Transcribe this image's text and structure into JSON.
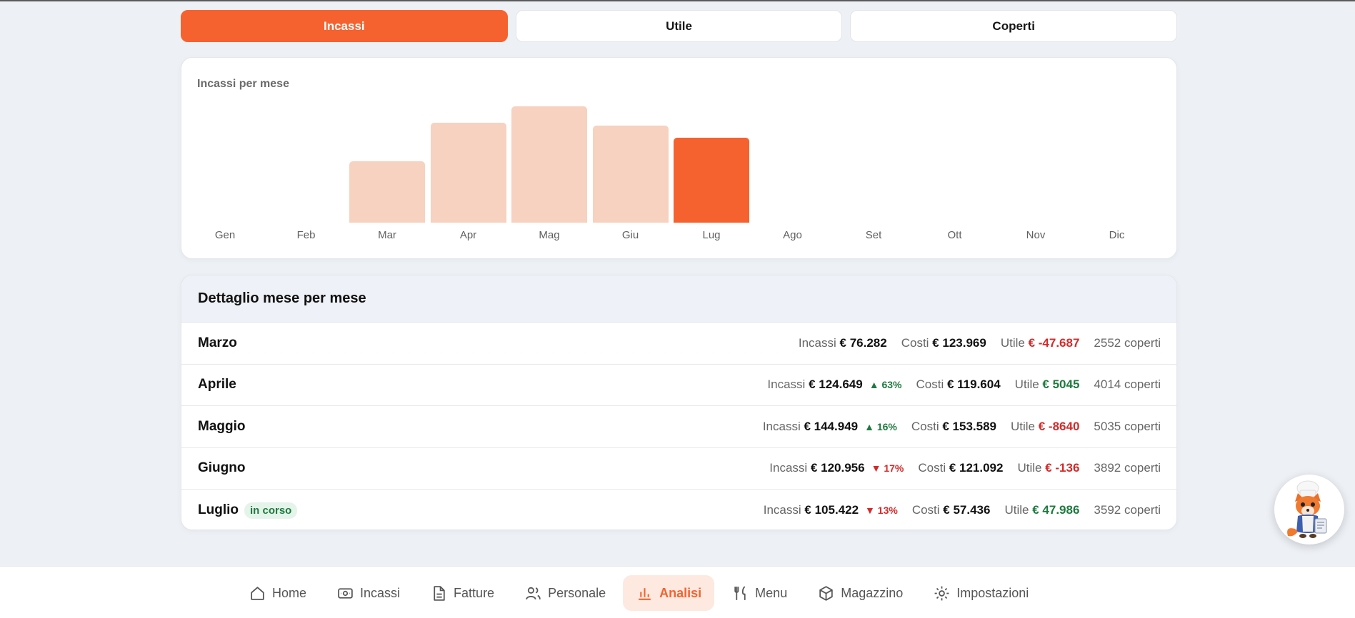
{
  "tabs": [
    {
      "label": "Incassi",
      "active": true
    },
    {
      "label": "Utile",
      "active": false
    },
    {
      "label": "Coperti",
      "active": false
    }
  ],
  "chart": {
    "title": "Incassi per mese"
  },
  "chart_data": {
    "type": "bar",
    "title": "Incassi per mese",
    "categories": [
      "Gen",
      "Feb",
      "Mar",
      "Apr",
      "Mag",
      "Giu",
      "Lug",
      "Ago",
      "Set",
      "Ott",
      "Nov",
      "Dic"
    ],
    "values": [
      null,
      null,
      76282,
      124649,
      144949,
      120956,
      105422,
      null,
      null,
      null,
      null,
      null
    ],
    "highlighted_category": "Lug",
    "colors": {
      "default": "#f7d2c0",
      "highlight": "#f5622f"
    },
    "grid": false
  },
  "detail": {
    "title": "Dettaglio mese per mese",
    "labels": {
      "incassi": "Incassi",
      "costi": "Costi",
      "utile": "Utile",
      "coperti_suffix": "coperti"
    },
    "rows": [
      {
        "month": "Marzo",
        "badge": "",
        "incassi": "€ 76.282",
        "delta": "",
        "delta_dir": "",
        "costi": "€ 123.969",
        "utile": "€ -47.687",
        "utile_sign": "neg",
        "coperti": "2552 coperti"
      },
      {
        "month": "Aprile",
        "badge": "",
        "incassi": "€ 124.649",
        "delta": "▲ 63%",
        "delta_dir": "pos",
        "costi": "€ 119.604",
        "utile": "€ 5045",
        "utile_sign": "pos",
        "coperti": "4014 coperti"
      },
      {
        "month": "Maggio",
        "badge": "",
        "incassi": "€ 144.949",
        "delta": "▲ 16%",
        "delta_dir": "pos",
        "costi": "€ 153.589",
        "utile": "€ -8640",
        "utile_sign": "neg",
        "coperti": "5035 coperti"
      },
      {
        "month": "Giugno",
        "badge": "",
        "incassi": "€ 120.956",
        "delta": "▼ 17%",
        "delta_dir": "neg",
        "costi": "€ 121.092",
        "utile": "€ -136",
        "utile_sign": "neg",
        "coperti": "3892 coperti"
      },
      {
        "month": "Luglio",
        "badge": "in corso",
        "incassi": "€ 105.422",
        "delta": "▼ 13%",
        "delta_dir": "neg",
        "costi": "€ 57.436",
        "utile": "€ 47.986",
        "utile_sign": "pos",
        "coperti": "3592 coperti"
      }
    ]
  },
  "nav": [
    {
      "label": "Home",
      "icon": "home-icon",
      "active": false
    },
    {
      "label": "Incassi",
      "icon": "cash-icon",
      "active": false
    },
    {
      "label": "Fatture",
      "icon": "document-icon",
      "active": false
    },
    {
      "label": "Personale",
      "icon": "users-icon",
      "active": false
    },
    {
      "label": "Analisi",
      "icon": "bar-chart-icon",
      "active": true
    },
    {
      "label": "Menu",
      "icon": "utensils-icon",
      "active": false
    },
    {
      "label": "Magazzino",
      "icon": "box-icon",
      "active": false
    },
    {
      "label": "Impostazioni",
      "icon": "settings-icon",
      "active": false
    }
  ],
  "assistant": {
    "icon": "fox-chef-avatar-icon"
  },
  "colors": {
    "accent": "#f5622f",
    "negative": "#d42a2a",
    "positive": "#1e7a3e"
  }
}
